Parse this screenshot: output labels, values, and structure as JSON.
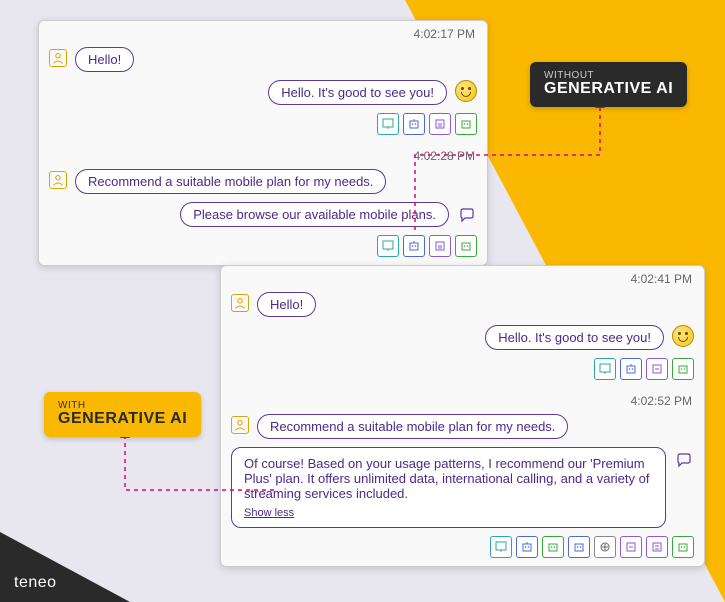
{
  "brand": "teneo",
  "badges": {
    "without": {
      "sub": "WITHOUT",
      "main": "GENERATIVE AI"
    },
    "with": {
      "sub": "WITH",
      "main": "GENERATIVE AI"
    }
  },
  "chat1": {
    "block1": {
      "ts": "4:02:17 PM",
      "user_msg": "Hello!",
      "bot_msg": "Hello. It's good to see you!"
    },
    "block2": {
      "ts": "4:02:28 PM",
      "user_msg": "Recommend a suitable mobile plan for my needs.",
      "bot_msg": "Please browse our available mobile plans."
    }
  },
  "chat2": {
    "block1": {
      "ts": "4:02:41 PM",
      "user_msg": "Hello!",
      "bot_msg": "Hello. It's good to see you!"
    },
    "block2": {
      "ts": "4:02:52 PM",
      "user_msg": "Recommend a suitable mobile plan for my needs.",
      "bot_msg": "Of course! Based on your usage patterns, I recommend our 'Premium Plus' plan. It offers unlimited data, international calling, and a variety of streaming services included.",
      "show_less": "Show less"
    }
  }
}
